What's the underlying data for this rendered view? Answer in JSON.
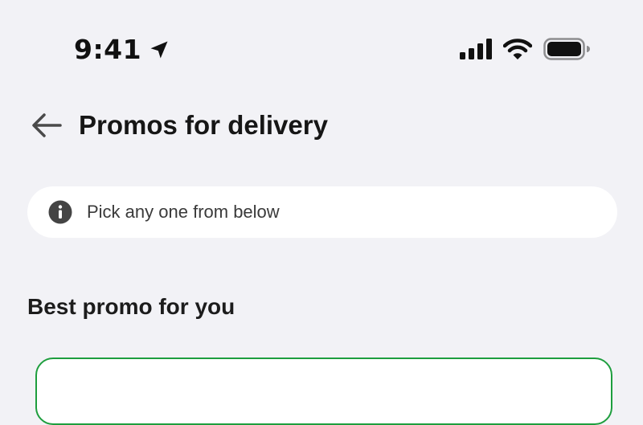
{
  "status_bar": {
    "time": "9:41",
    "icons": [
      "location-arrow-icon",
      "cellular-signal-icon",
      "wifi-icon",
      "battery-icon"
    ]
  },
  "header": {
    "title": "Promos for delivery",
    "back_icon": "arrow-left-icon"
  },
  "info_banner": {
    "icon": "info-icon",
    "text": "Pick any one from below"
  },
  "section": {
    "heading": "Best promo for you"
  },
  "colors": {
    "background": "#f2f2f6",
    "card_background": "#ffffff",
    "selected_border": "#1e9e3e",
    "text_primary": "#161616",
    "text_secondary": "#3a3a3a",
    "icon_gray": "#444444"
  }
}
